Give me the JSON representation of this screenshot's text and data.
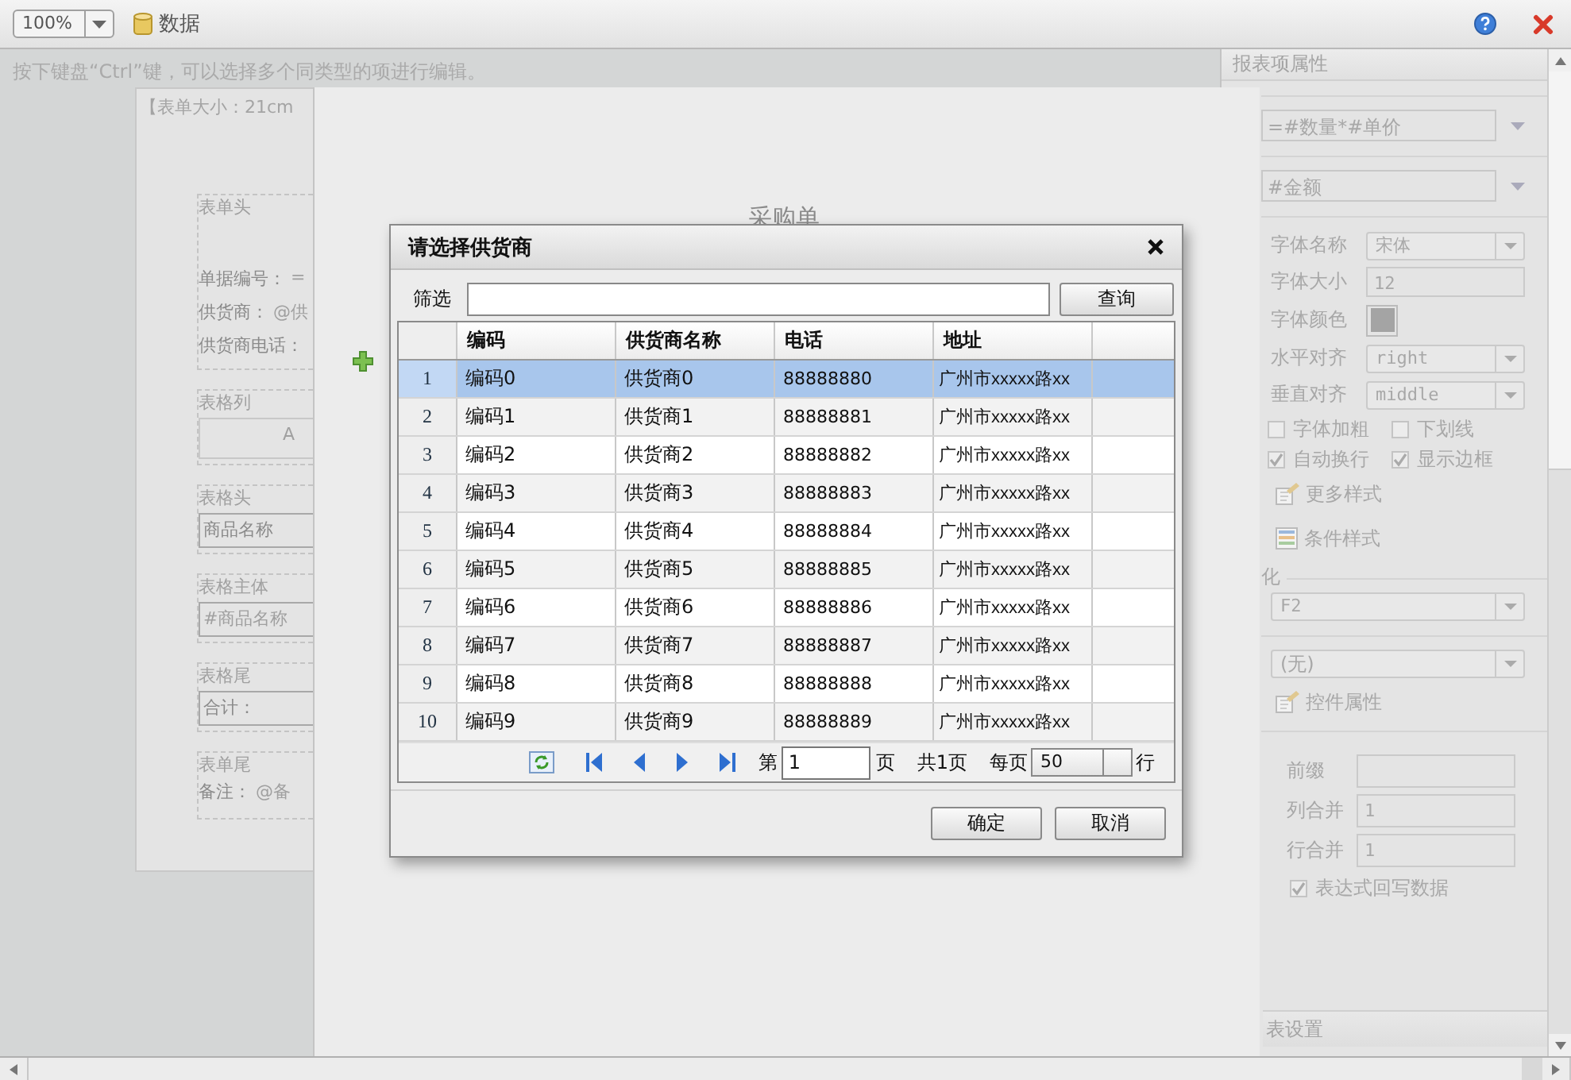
{
  "toolbar": {
    "zoom": "100%",
    "data_button": "数据"
  },
  "hint": "按下键盘“Ctrl”键，可以选择多个同类型的项进行编辑。",
  "designer": {
    "size_label": "【表单大小：21cm",
    "header": {
      "title": "表单头",
      "lines": [
        {
          "label": "单据编号：",
          "value": "="
        },
        {
          "label": "供货商：",
          "value": "@供"
        },
        {
          "label": "供货商电话："
        }
      ]
    },
    "boxes": [
      {
        "title": "表格列",
        "text": "A",
        "kind": "column"
      },
      {
        "title": "表格头",
        "text": "商品名称",
        "kind": "plain"
      },
      {
        "title": "表格主体",
        "text": "#商品名称",
        "kind": "faint"
      },
      {
        "title": "表格尾",
        "text": "合计：",
        "kind": "plain"
      }
    ],
    "footer": {
      "title": "表单尾",
      "label": "备注：",
      "value": "@备"
    }
  },
  "paper": {
    "title": "采购单"
  },
  "properties": {
    "title": "报表项属性",
    "expression": "=#数量*#单价",
    "display": "#金额",
    "font_rows": [
      {
        "label": "字体名称",
        "kind": "select",
        "value": "宋体"
      },
      {
        "label": "字体大小",
        "kind": "input",
        "value": "12"
      },
      {
        "label": "字体颜色",
        "kind": "color",
        "color": "#a4a4a4"
      },
      {
        "label": "水平对齐",
        "kind": "select",
        "value": "right"
      },
      {
        "label": "垂直对齐",
        "kind": "select",
        "value": "middle"
      }
    ],
    "options": [
      {
        "label": "字体加粗",
        "checked": false
      },
      {
        "label": "下划线",
        "checked": false
      },
      {
        "label": "自动换行",
        "checked": true
      },
      {
        "label": "显示边框",
        "checked": true
      }
    ],
    "links": [
      {
        "label": "更多样式",
        "kind": "edit"
      },
      {
        "label": "条件样式",
        "kind": "grid"
      }
    ],
    "format_title": "化",
    "format": "F2",
    "control": "(无)",
    "control_link": {
      "label": "控件属性",
      "kind": "edit"
    },
    "cell_rows": [
      {
        "label": "前缀"
      },
      {
        "label": "列合并",
        "value": "1"
      },
      {
        "label": "行合并",
        "value": "1"
      }
    ],
    "writeback": {
      "label": "表达式回写数据",
      "checked": true
    },
    "table_settings": "表设置"
  },
  "dialog": {
    "title": "请选择供货商",
    "filter_label": "筛选",
    "search_button": "查询",
    "columns": [
      "编码",
      "供货商名称",
      "电话",
      "地址"
    ],
    "rows": [
      {
        "index": "1",
        "code": "编码0",
        "name": "供货商0",
        "phone": "88888880",
        "address": "广州市xxxxx路xx",
        "selected": true
      },
      {
        "index": "2",
        "code": "编码1",
        "name": "供货商1",
        "phone": "88888881",
        "address": "广州市xxxxx路xx",
        "selected": false
      },
      {
        "index": "3",
        "code": "编码2",
        "name": "供货商2",
        "phone": "88888882",
        "address": "广州市xxxxx路xx",
        "selected": false
      },
      {
        "index": "4",
        "code": "编码3",
        "name": "供货商3",
        "phone": "88888883",
        "address": "广州市xxxxx路xx",
        "selected": false
      },
      {
        "index": "5",
        "code": "编码4",
        "name": "供货商4",
        "phone": "88888884",
        "address": "广州市xxxxx路xx",
        "selected": false
      },
      {
        "index": "6",
        "code": "编码5",
        "name": "供货商5",
        "phone": "88888885",
        "address": "广州市xxxxx路xx",
        "selected": false
      },
      {
        "index": "7",
        "code": "编码6",
        "name": "供货商6",
        "phone": "88888886",
        "address": "广州市xxxxx路xx",
        "selected": false
      },
      {
        "index": "8",
        "code": "编码7",
        "name": "供货商7",
        "phone": "88888887",
        "address": "广州市xxxxx路xx",
        "selected": false
      },
      {
        "index": "9",
        "code": "编码8",
        "name": "供货商8",
        "phone": "88888888",
        "address": "广州市xxxxx路xx",
        "selected": false
      },
      {
        "index": "10",
        "code": "编码9",
        "name": "供货商9",
        "phone": "88888889",
        "address": "广州市xxxxx路xx",
        "selected": false
      }
    ],
    "pager": {
      "page_prefix": "第",
      "page": "1",
      "page_suffix": "页",
      "total": "共1页",
      "per_page_label": "每页",
      "per_page": "50",
      "per_page_suffix": "行"
    },
    "buttons": [
      "确定",
      "取消"
    ]
  }
}
